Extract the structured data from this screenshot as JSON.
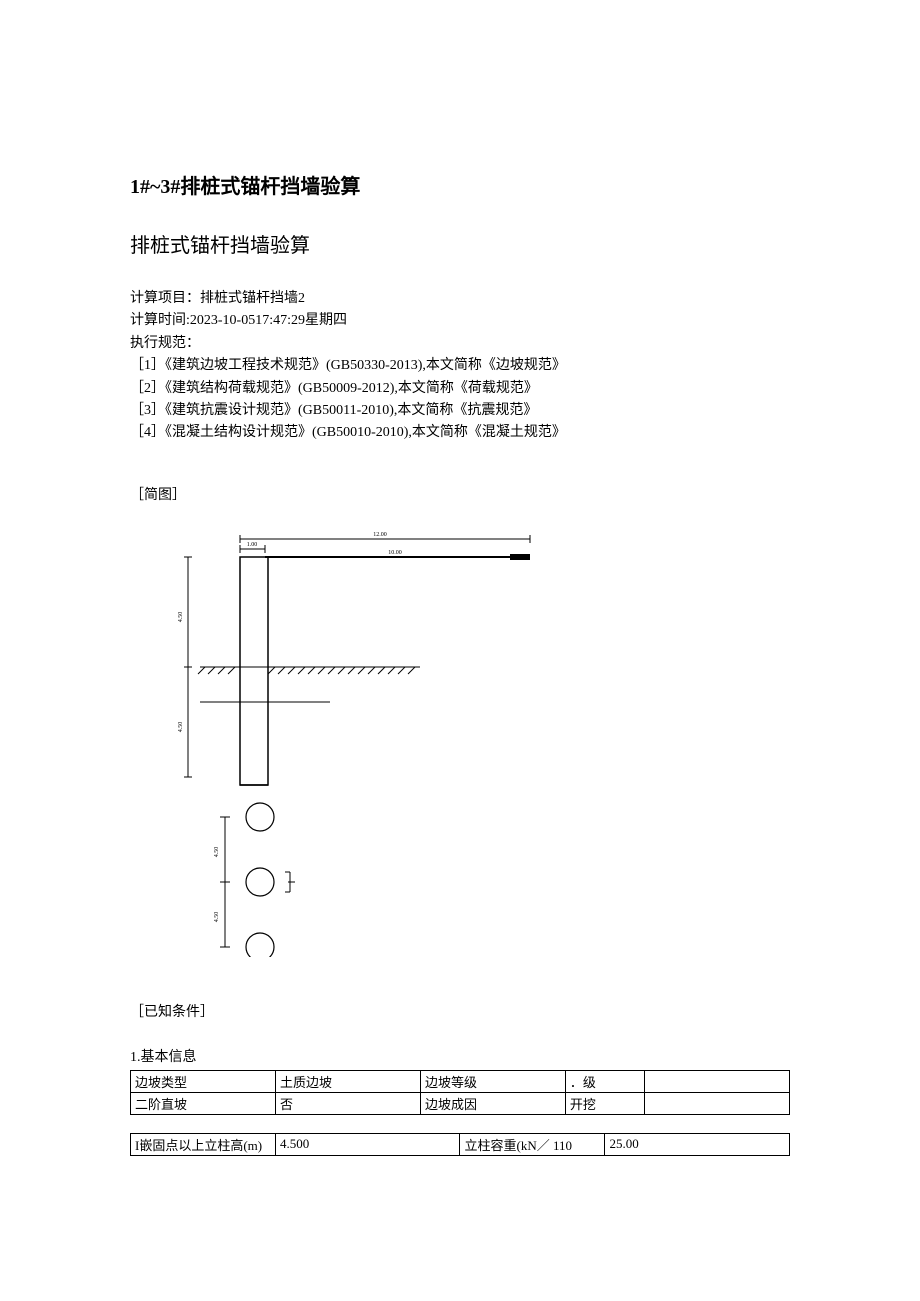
{
  "title1": "1#~3#排桩式锚杆挡墙验算",
  "title2": "排桩式锚杆挡墙验算",
  "meta": {
    "project_label": "计算项目：",
    "project_value": "排桩式锚杆挡墙2",
    "time_label": "计算时间:",
    "time_value": "2023-10-0517:47:29星期四",
    "exec_label": "执行规范："
  },
  "refs": [
    "［1］《建筑边坡工程技术规范》(GB50330-2013),本文简称《边坡规范》",
    "［2］《建筑结构荷载规范》(GB50009-2012),本文简称《荷载规范》",
    "［3］《建筑抗震设计规范》(GB50011-2010),本文简称《抗震规范》",
    "［4］《混凝土结构设计规范》(GB50010-2010),本文简称《混凝土规范》"
  ],
  "section_diagram": "［简图］",
  "section_conditions": "［已知条件］",
  "basic_info_label": "1.基本信息",
  "table1": {
    "r1c1": "边坡类型",
    "r1c2": "土质边坡",
    "r1c3": "边坡等级",
    "r1c4": "．级",
    "r2c1": "二阶直坡",
    "r2c2": "否",
    "r2c3": "边坡成因",
    "r2c4": "开挖"
  },
  "table2": {
    "r1c1": "I嵌固点以上立柱高(m)",
    "r1c2": "4.500",
    "r1c3": "立柱容重(kN／ 110",
    "r1c4": "25.00"
  },
  "diagram_labels": {
    "top_dim": "12.00",
    "top_dim2": "10.00",
    "left_dim_small": "1.00",
    "left_dim_upper": "4.50",
    "left_dim_lower": "4.50",
    "circle_dim_upper": "4.50",
    "circle_dim_lower": "4.50"
  }
}
